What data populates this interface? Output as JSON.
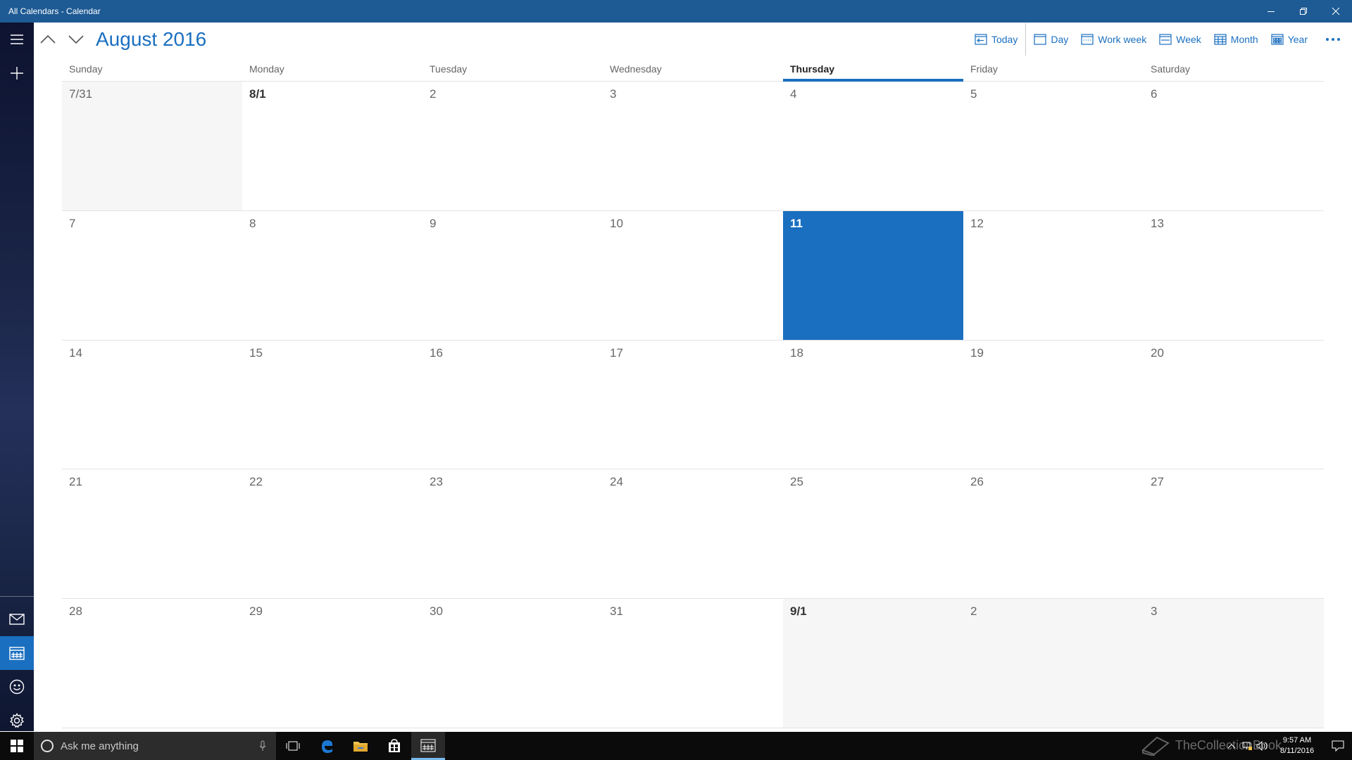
{
  "window": {
    "title": "All Calendars - Calendar"
  },
  "header": {
    "month_title": "August 2016",
    "views": [
      {
        "label": "Today",
        "icon": "today-icon"
      },
      {
        "label": "Day",
        "icon": "day-view-icon"
      },
      {
        "label": "Work week",
        "icon": "work-week-icon"
      },
      {
        "label": "Week",
        "icon": "week-icon"
      },
      {
        "label": "Month",
        "icon": "month-icon"
      },
      {
        "label": "Year",
        "icon": "year-icon"
      }
    ]
  },
  "weekdays": [
    "Sunday",
    "Monday",
    "Tuesday",
    "Wednesday",
    "Thursday",
    "Friday",
    "Saturday"
  ],
  "current_weekday": "Thursday",
  "weeks": [
    [
      "7/31",
      "8/1",
      "2",
      "3",
      "4",
      "5",
      "6"
    ],
    [
      "7",
      "8",
      "9",
      "10",
      "11",
      "12",
      "13"
    ],
    [
      "14",
      "15",
      "16",
      "17",
      "18",
      "19",
      "20"
    ],
    [
      "21",
      "22",
      "23",
      "24",
      "25",
      "26",
      "27"
    ],
    [
      "28",
      "29",
      "30",
      "31",
      "9/1",
      "2",
      "3"
    ]
  ],
  "today": "11",
  "taskbar": {
    "search_placeholder": "Ask me anything",
    "time": "9:57 AM",
    "date": "8/11/2016",
    "watermark": "TheCollectionBook"
  },
  "colors": {
    "accent": "#1a6fc0",
    "titlebar": "#1e5a94",
    "other_month_bg": "#f6f6f6"
  }
}
